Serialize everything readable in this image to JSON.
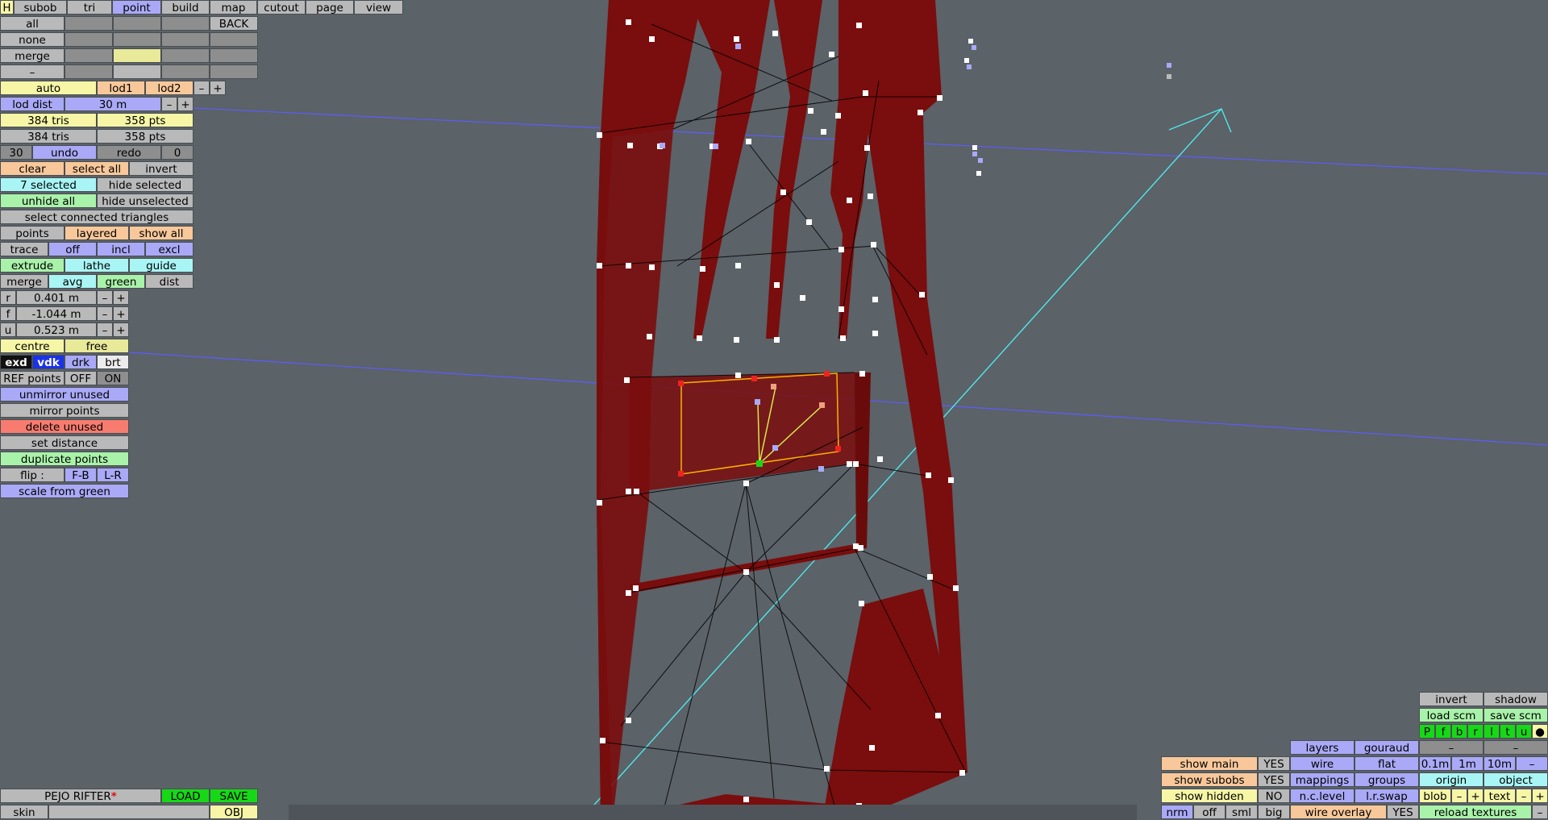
{
  "menu": {
    "h": "H",
    "items": [
      "subob",
      "tri",
      "point",
      "build",
      "map",
      "cutout",
      "page",
      "view"
    ],
    "active": "point"
  },
  "sel": {
    "all": "all",
    "none": "none",
    "merge": "merge",
    "dash": "–",
    "back": "BACK"
  },
  "lod": {
    "auto": "auto",
    "lod1": "lod1",
    "lod2": "lod2",
    "minus": "–",
    "plus": "+",
    "dist_label": "lod dist",
    "dist_value": "30 m"
  },
  "stats": {
    "tris1": "384 tris",
    "pts1": "358 pts",
    "tris2": "384 tris",
    "pts2": "358 pts"
  },
  "undo": {
    "count": "30",
    "undo": "undo",
    "redo": "redo",
    "redo_count": "0"
  },
  "select": {
    "clear": "clear",
    "select_all": "select all",
    "invert": "invert",
    "selected": "7 selected",
    "hide_selected": "hide selected",
    "unhide_all": "unhide all",
    "hide_unselected": "hide unselected",
    "connected": "select connected triangles"
  },
  "modes": {
    "points": "points",
    "layered": "layered",
    "show_all": "show all",
    "trace": "trace",
    "off": "off",
    "incl": "incl",
    "excl": "excl",
    "extrude": "extrude",
    "lathe": "lathe",
    "guide": "guide",
    "merge": "merge",
    "avg": "avg",
    "green": "green",
    "dist": "dist"
  },
  "coords": [
    {
      "axis": "r",
      "value": "0.401 m"
    },
    {
      "axis": "f",
      "value": "-1.044 m"
    },
    {
      "axis": "u",
      "value": "0.523 m"
    }
  ],
  "pivot": {
    "centre": "centre",
    "free": "free"
  },
  "colors": {
    "exd": "exd",
    "vdk": "vdk",
    "drk": "drk",
    "brt": "brt"
  },
  "ref": {
    "label": "REF points",
    "off": "OFF",
    "on": "ON"
  },
  "actions": {
    "unmirror": "unmirror unused",
    "mirror": "mirror points",
    "delete": "delete unused",
    "set_distance": "set distance",
    "duplicate": "duplicate points",
    "flip_label": "flip :",
    "fb": "F-B",
    "lr": "L-R",
    "scale": "scale from green"
  },
  "file": {
    "name": "PEJO RIFTER",
    "modified": "*",
    "load": "LOAD",
    "save": "SAVE",
    "skin": "skin",
    "obj": "OBJ"
  },
  "display": {
    "show_main": "show main",
    "show_main_val": "YES",
    "show_subobs": "show subobs",
    "show_subobs_val": "YES",
    "show_hidden": "show hidden",
    "show_hidden_val": "NO",
    "nrm": "nrm",
    "off": "off",
    "sml": "sml",
    "big": "big",
    "layers": "layers",
    "gouraud": "gouraud",
    "wire": "wire",
    "flat": "flat",
    "mappings": "mappings",
    "groups": "groups",
    "nc_level": "n.c.level",
    "lr_swap": "l.r.swap",
    "wire_overlay": "wire overlay",
    "wire_overlay_val": "YES",
    "invert": "invert",
    "shadow": "shadow",
    "load_scm": "load scm",
    "save_scm": "save scm",
    "views": [
      "P",
      "f",
      "b",
      "r",
      "l",
      "t",
      "u"
    ],
    "dash": "–",
    "steps": [
      "0.1m",
      "1m",
      "10m"
    ],
    "origin": "origin",
    "object": "object",
    "blob": "blob",
    "minus": "–",
    "plus": "+",
    "text": "text",
    "reload": "reload textures"
  },
  "scene_colors": {
    "hull": "#7a0d0d",
    "hull_dark": "#5a0808",
    "wire": "#000000",
    "axis_blue": "#5c5cff",
    "axis_cyan": "#4fe8e8",
    "selection": "#ffb000",
    "vertex": "#ffffff"
  }
}
